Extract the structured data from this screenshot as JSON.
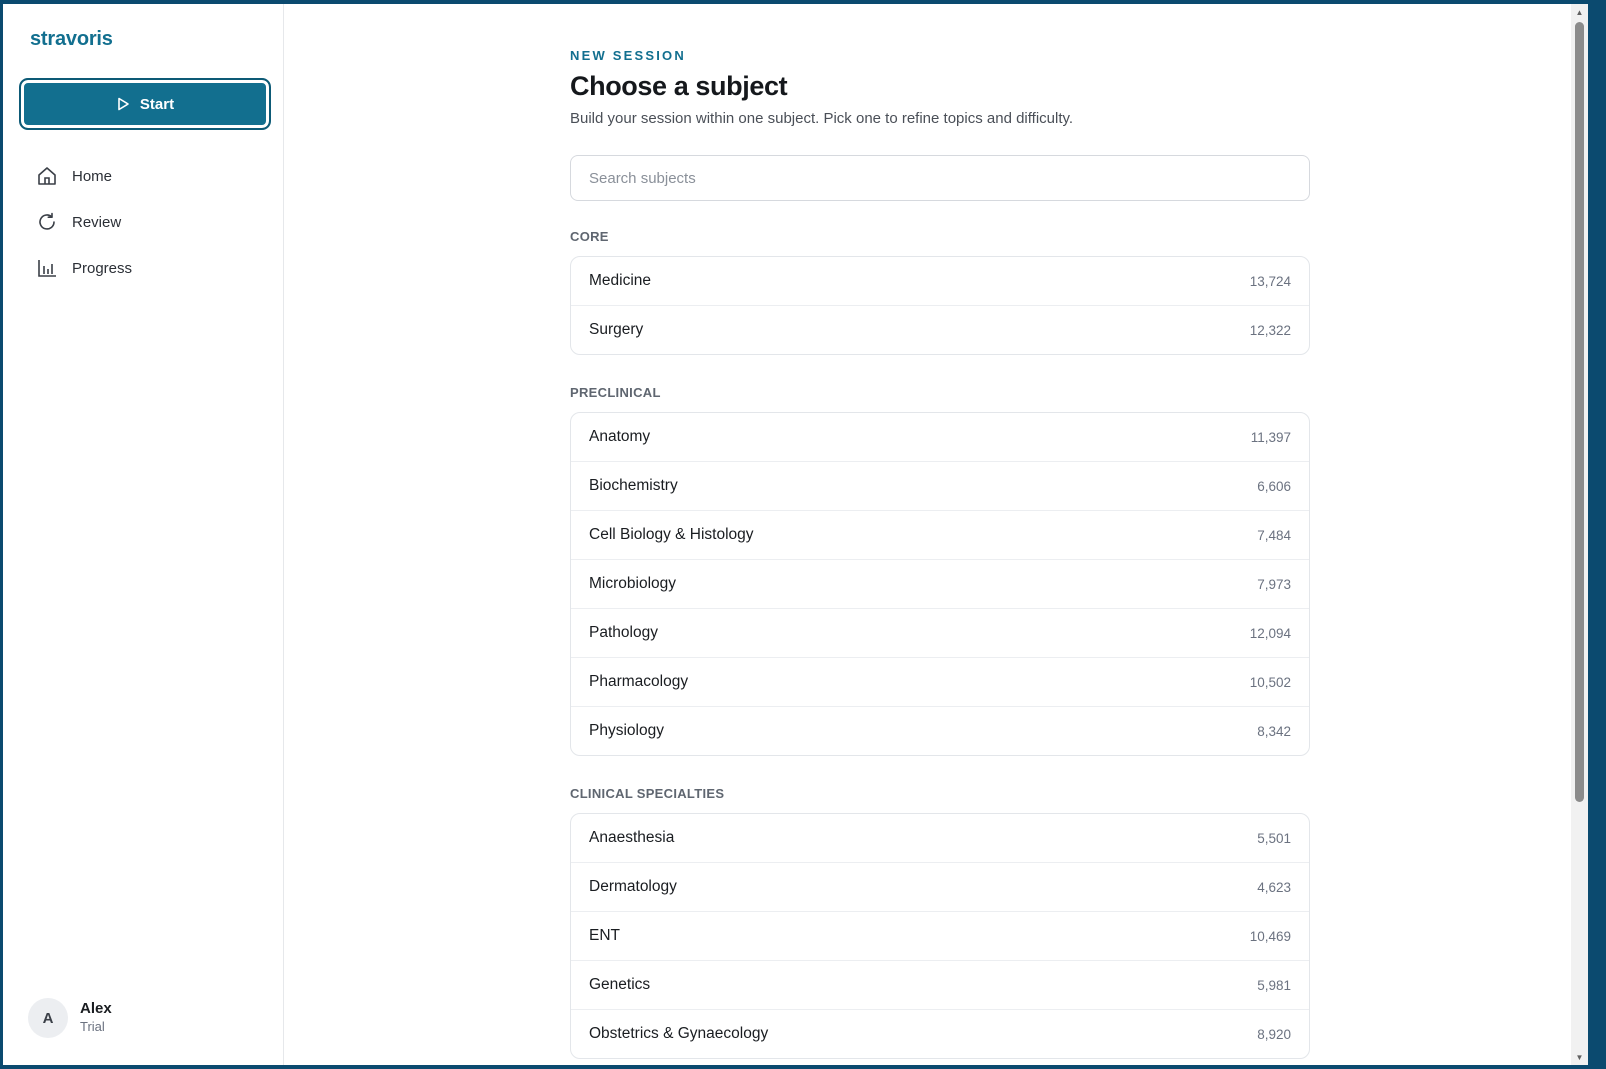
{
  "sidebar": {
    "brand": "stravoris",
    "start_label": "Start",
    "nav": [
      {
        "label": "Home",
        "icon": "home-icon"
      },
      {
        "label": "Review",
        "icon": "refresh-icon"
      },
      {
        "label": "Progress",
        "icon": "bar-chart-icon"
      }
    ],
    "user": {
      "initial": "A",
      "name": "Alex",
      "plan": "Trial"
    }
  },
  "main": {
    "eyebrow": "NEW SESSION",
    "title": "Choose a subject",
    "subtitle": "Build your session within one subject. Pick one to refine topics and difficulty.",
    "search_placeholder": "Search subjects",
    "groups": [
      {
        "label": "CORE",
        "items": [
          {
            "name": "Medicine",
            "count": "13,724"
          },
          {
            "name": "Surgery",
            "count": "12,322"
          }
        ]
      },
      {
        "label": "PRECLINICAL",
        "items": [
          {
            "name": "Anatomy",
            "count": "11,397"
          },
          {
            "name": "Biochemistry",
            "count": "6,606"
          },
          {
            "name": "Cell Biology & Histology",
            "count": "7,484"
          },
          {
            "name": "Microbiology",
            "count": "7,973"
          },
          {
            "name": "Pathology",
            "count": "12,094"
          },
          {
            "name": "Pharmacology",
            "count": "10,502"
          },
          {
            "name": "Physiology",
            "count": "8,342"
          }
        ]
      },
      {
        "label": "CLINICAL SPECIALTIES",
        "items": [
          {
            "name": "Anaesthesia",
            "count": "5,501"
          },
          {
            "name": "Dermatology",
            "count": "4,623"
          },
          {
            "name": "ENT",
            "count": "10,469"
          },
          {
            "name": "Genetics",
            "count": "5,981"
          },
          {
            "name": "Obstetrics & Gynaecology",
            "count": "8,920"
          }
        ]
      }
    ]
  },
  "colors": {
    "accent": "#126f8f",
    "frame": "#0b4a6f"
  }
}
